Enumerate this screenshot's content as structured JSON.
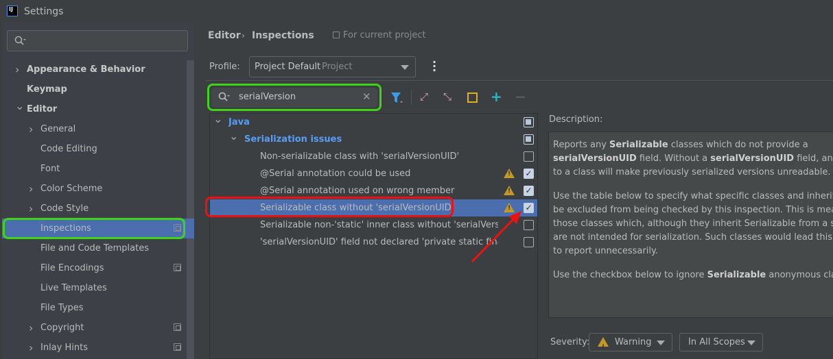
{
  "window": {
    "title": "Settings"
  },
  "sidebar": {
    "search_placeholder": "",
    "items": [
      {
        "label": "Appearance & Behavior",
        "level": 0,
        "expandable": true,
        "expanded": false,
        "bold": true
      },
      {
        "label": "Keymap",
        "level": 0,
        "bold": true
      },
      {
        "label": "Editor",
        "level": 0,
        "expandable": true,
        "expanded": true,
        "bold": true
      },
      {
        "label": "General",
        "level": 1,
        "expandable": true
      },
      {
        "label": "Code Editing",
        "level": 1
      },
      {
        "label": "Font",
        "level": 1
      },
      {
        "label": "Color Scheme",
        "level": 1,
        "expandable": true
      },
      {
        "label": "Code Style",
        "level": 1,
        "expandable": true
      },
      {
        "label": "Inspections",
        "level": 1,
        "selected": true,
        "project_icon": true
      },
      {
        "label": "File and Code Templates",
        "level": 1
      },
      {
        "label": "File Encodings",
        "level": 1,
        "project_icon": true
      },
      {
        "label": "Live Templates",
        "level": 1
      },
      {
        "label": "File Types",
        "level": 1
      },
      {
        "label": "Copyright",
        "level": 1,
        "expandable": true,
        "project_icon": true
      },
      {
        "label": "Inlay Hints",
        "level": 1,
        "expandable": true,
        "project_icon": true
      }
    ]
  },
  "breadcrumb": {
    "parent": "Editor",
    "current": "Inspections",
    "scope_note": "For current project"
  },
  "profile": {
    "label": "Profile:",
    "value": "Project Default",
    "value_hint": "Project"
  },
  "inspection_search": {
    "value": "serialVersion"
  },
  "inspections_tree": [
    {
      "label": "Java",
      "level": 0,
      "category": true,
      "state": "partial"
    },
    {
      "label": "Serialization issues",
      "level": 1,
      "category": true,
      "state": "partial"
    },
    {
      "label": "Non-serializable class with 'serialVersionUID'",
      "level": 2,
      "checked": false,
      "warning": false
    },
    {
      "label": "@Serial annotation could be used",
      "level": 2,
      "checked": true,
      "warning": true
    },
    {
      "label": "@Serial annotation used on wrong member",
      "level": 2,
      "checked": true,
      "warning": true
    },
    {
      "label": "Serializable class without 'serialVersionUID'",
      "level": 2,
      "checked": true,
      "warning": true,
      "selected": true
    },
    {
      "label": "Serializable non-'static' inner class without 'serialVersionUID'",
      "level": 2,
      "checked": false,
      "warning": false
    },
    {
      "label": "'serialVersionUID' field not declared 'private static final long'",
      "level": 2,
      "checked": false,
      "warning": false
    }
  ],
  "description": {
    "label": "Description:",
    "p1": [
      "Reports any ",
      "Serializable",
      " classes which do not provide a"
    ],
    "p1b": [
      "serialVersionUID",
      " field. Without a ",
      "serialVersionUID",
      " field, any changes"
    ],
    "p1c": "to a class will make previously serialized versions unreadable.",
    "p2": [
      "Use the table below to specify what specific classes and inheritors should",
      "be excluded from being checked by this inspection. This is meant for",
      "those classes which, although they inherit Serializable from a superclass,",
      "are not intended for serialization. Such classes would lead this inspection",
      "to report unnecessarily."
    ],
    "p3": [
      "Use the checkbox below to ignore ",
      "Serializable",
      " anonymous classes."
    ]
  },
  "severity": {
    "label": "Severity:",
    "value": "Warning",
    "scope": "In All Scopes"
  },
  "colors": {
    "selection": "#4b6eaf",
    "accent_green_highlight": "#3fd41a",
    "accent_red_highlight": "#ee1111",
    "warning": "#c39a27",
    "category_blue": "#589df6"
  }
}
